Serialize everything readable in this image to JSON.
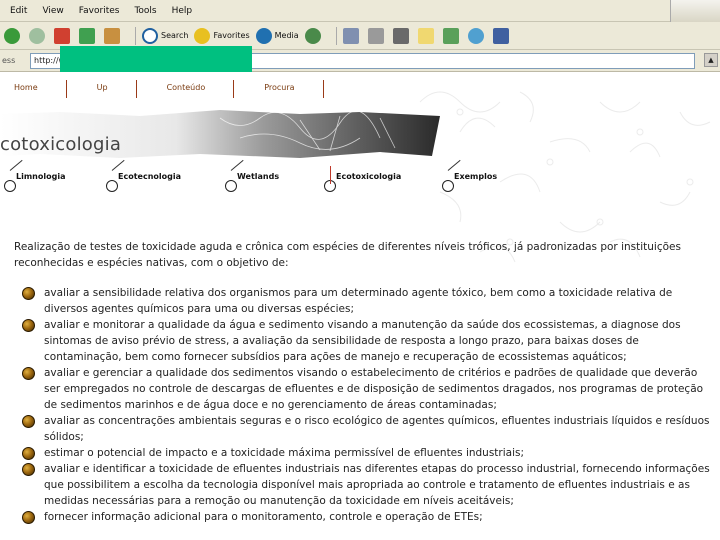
{
  "menu": {
    "items": [
      "Edit",
      "View",
      "Favorites",
      "Tools",
      "Help"
    ]
  },
  "toolbar": {
    "search_label": "Search",
    "favorites_label": "Favorites",
    "media_label": "Media"
  },
  "addressbar": {
    "label": "ess",
    "url": "http://w"
  },
  "colors": {
    "redaction": "#00c080",
    "nav_text": "#7a3b10",
    "chrome": "#ece9d8"
  },
  "nav": {
    "items": [
      "Home",
      "Up",
      "Conteúdo",
      "Procura"
    ]
  },
  "banner": {
    "title": "cotoxicologia"
  },
  "subnav": {
    "items": [
      "Limnologia",
      "Ecotecnologia",
      "Wetlands",
      "Ecotoxicologia",
      "Exemplos"
    ]
  },
  "content": {
    "intro": "Realização de testes de toxicidade aguda e crônica com espécies de diferentes níveis tróficos, já padronizadas por instituições reconhecidas e espécies nativas, com o objetivo de:",
    "bullets": [
      "avaliar a sensibilidade relativa dos organismos para um determinado agente tóxico, bem como a toxicidade relativa de diversos agentes químicos para uma ou diversas espécies;",
      "avaliar e monitorar a qualidade da água e sedimento visando a manutenção da saúde dos ecossistemas, a diagnose dos sintomas de aviso prévio de stress, a avaliação da sensibilidade de resposta a longo prazo, para baixas doses de contaminação, bem como fornecer subsídios para ações de manejo e recuperação de ecossistemas aquáticos;",
      "avaliar e gerenciar a qualidade dos sedimentos visando o estabelecimento de critérios e padrões de qualidade que deverão ser empregados no controle de descargas de efluentes e de disposição de sedimentos dragados, nos programas de proteção de sedimentos marinhos e de água doce e no gerenciamento de áreas contaminadas;",
      "avaliar as concentrações ambientais seguras e o risco ecológico de agentes químicos, efluentes industriais líquidos e resíduos sólidos;",
      "estimar o potencial de impacto e a toxicidade máxima permissível de efluentes industriais;",
      "avaliar e identificar a toxicidade de efluentes industriais nas diferentes etapas do processo industrial, fornecendo informações que possibilitem a escolha da tecnologia disponível mais apropriada ao controle e tratamento de efluentes industriais e as medidas necessárias para a remoção ou manutenção da toxicidade em níveis aceitáveis;",
      "fornecer informação adicional para o monitoramento, controle e operação de ETEs;"
    ]
  }
}
